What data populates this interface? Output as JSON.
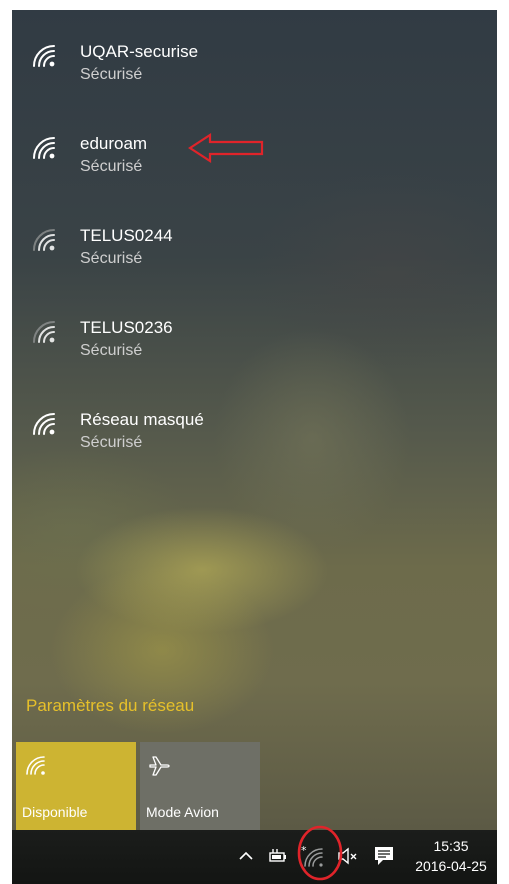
{
  "networks": [
    {
      "name": "UQAR-securise",
      "status": "Sécurisé",
      "signal_icon": "wifi-full-icon"
    },
    {
      "name": "eduroam",
      "status": "Sécurisé",
      "signal_icon": "wifi-full-icon"
    },
    {
      "name": "TELUS0244",
      "status": "Sécurisé",
      "signal_icon": "wifi-medium-icon"
    },
    {
      "name": "TELUS0236",
      "status": "Sécurisé",
      "signal_icon": "wifi-medium-icon"
    },
    {
      "name": "Réseau masqué",
      "status": "Sécurisé",
      "signal_icon": "wifi-full-icon"
    }
  ],
  "settings_link": "Paramètres du réseau",
  "tiles": {
    "wifi": {
      "label": "Disponible",
      "icon": "wifi-icon",
      "state": "on"
    },
    "airplane": {
      "label": "Mode Avion",
      "icon": "airplane-icon",
      "state": "off"
    }
  },
  "taskbar": {
    "time": "15:35",
    "date": "2016-04-25",
    "icons": [
      "chevron-up-icon",
      "power-plug-icon",
      "wifi-status-icon",
      "volume-muted-icon",
      "notification-icon"
    ]
  },
  "annotations": {
    "arrow_color": "#e0242a",
    "circle_color": "#e0242a"
  },
  "colors": {
    "accent": "#cdb432",
    "settings_link": "#e6c02a",
    "taskbar": "#151715"
  }
}
